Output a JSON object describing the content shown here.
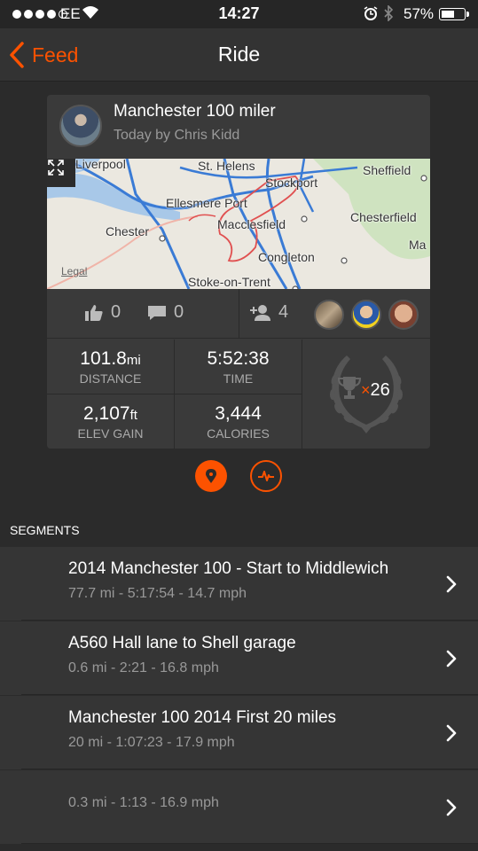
{
  "status": {
    "carrier": "EE",
    "time": "14:27",
    "battery": "57%",
    "battery_level": 0.57
  },
  "nav": {
    "back_label": "Feed",
    "title": "Ride"
  },
  "activity": {
    "title": "Manchester 100 miler",
    "subtitle": "Today by Chris Kidd",
    "map": {
      "legal": "Legal",
      "labels": {
        "liverpool": "Liverpool",
        "st_helens": "St. Helens",
        "sheffield": "Sheffield",
        "stockport": "Stockport",
        "ellesmere_port": "Ellesmere Port",
        "chesterfield": "Chesterfield",
        "chester": "Chester",
        "macclesfield": "Macclesfield",
        "ma": "Ma",
        "congleton": "Congleton",
        "stoke": "Stoke-on-Trent"
      }
    },
    "kudos": "0",
    "comments": "0",
    "athletes": "4",
    "stats": {
      "distance": {
        "value": "101.8",
        "unit": "mi",
        "label": "DISTANCE"
      },
      "time": {
        "value": "5:52:38",
        "label": "TIME"
      },
      "elev": {
        "value": "2,107",
        "unit": "ft",
        "label": "ELEV GAIN"
      },
      "calories": {
        "value": "3,444",
        "label": "CALORIES"
      }
    },
    "achievements": {
      "x": "×",
      "count": "26"
    }
  },
  "segments": {
    "header": "SEGMENTS",
    "items": [
      {
        "name": "2014 Manchester 100 - Start to Middlewich",
        "meta": "77.7 mi - 5:17:54 - 14.7 mph"
      },
      {
        "name": "A560 Hall lane to Shell garage",
        "meta": "0.6 mi - 2:21 - 16.8 mph"
      },
      {
        "name": "Manchester 100 2014 First 20 miles",
        "meta": "20 mi - 1:07:23 - 17.9 mph"
      },
      {
        "name": "",
        "meta": "0.3 mi - 1:13 - 16.9 mph"
      }
    ]
  },
  "colors": {
    "accent": "#fc5200",
    "background": "#2b2b2b",
    "card": "#3a3a3a"
  }
}
